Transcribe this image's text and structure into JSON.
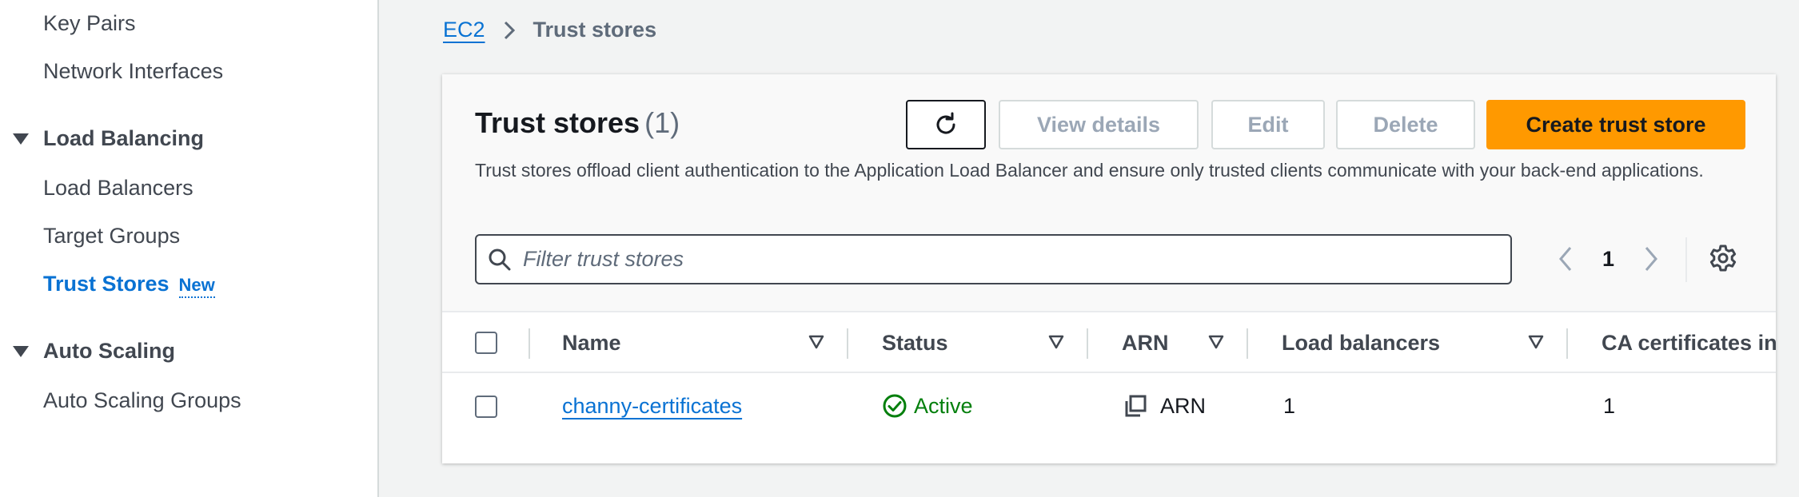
{
  "sidebar": {
    "items_top": [
      "Key Pairs",
      "Network Interfaces"
    ],
    "section_load_balancing": "Load Balancing",
    "load_balancing_items": [
      "Load Balancers",
      "Target Groups"
    ],
    "active_item": "Trust Stores",
    "active_badge": "New",
    "section_auto_scaling": "Auto Scaling",
    "auto_scaling_items": [
      "Auto Scaling Groups"
    ]
  },
  "breadcrumb": {
    "root": "EC2",
    "current": "Trust stores"
  },
  "panel": {
    "title": "Trust stores",
    "count": "(1)",
    "description": "Trust stores offload client authentication to the Application Load Balancer and ensure only trusted clients communicate with your back-end applications.",
    "buttons": {
      "view_details": "View details",
      "edit": "Edit",
      "delete": "Delete",
      "create": "Create trust store"
    },
    "search_placeholder": "Filter trust stores",
    "page_number": "1"
  },
  "table": {
    "columns": [
      "Name",
      "Status",
      "ARN",
      "Load balancers",
      "CA certificates in"
    ],
    "rows": [
      {
        "name": "channy-certificates",
        "status": "Active",
        "arn": "ARN",
        "load_balancers": "1",
        "ca_certificates": "1"
      }
    ]
  },
  "colors": {
    "accent": "#0972d3",
    "primary_button": "#ff9900",
    "status_active": "#037f0c"
  },
  "icons": {
    "refresh": "refresh-icon",
    "search": "search-icon",
    "settings": "gear-icon",
    "copy": "copy-icon",
    "status": "check-circle-icon"
  }
}
